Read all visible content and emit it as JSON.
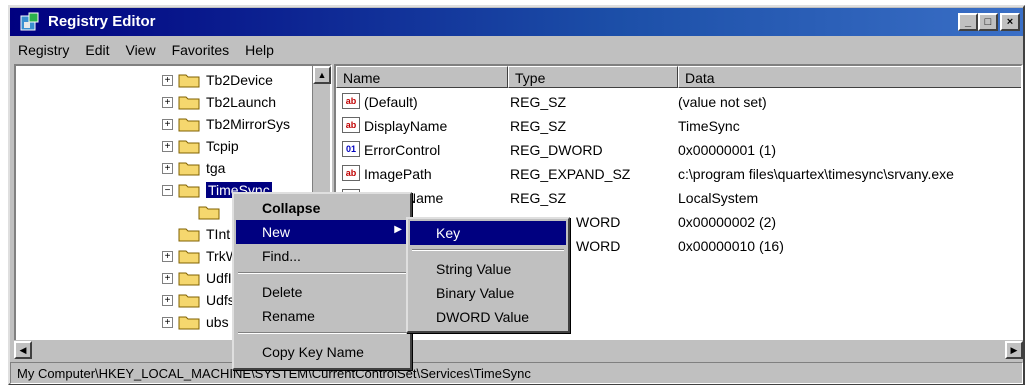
{
  "window": {
    "title": "Registry Editor",
    "buttons": [
      "_",
      "□",
      "×"
    ]
  },
  "menubar": [
    "Registry",
    "Edit",
    "View",
    "Favorites",
    "Help"
  ],
  "tree": {
    "items": [
      {
        "label": "Tb2Device",
        "expander": "+"
      },
      {
        "label": "Tb2Launch",
        "expander": "+"
      },
      {
        "label": "Tb2MirrorSys",
        "expander": "+"
      },
      {
        "label": "Tcpip",
        "expander": "+"
      },
      {
        "label": "tga",
        "expander": "+"
      },
      {
        "label": "TimeSync",
        "expander": "−",
        "selected": true
      },
      {
        "label": "",
        "expander": ""
      },
      {
        "label": "TInt",
        "expander": ""
      },
      {
        "label": "TrkW",
        "expander": "+"
      },
      {
        "label": "UdfI",
        "expander": "+"
      },
      {
        "label": "Udfs",
        "expander": "+"
      },
      {
        "label": "ubs",
        "expander": "+"
      }
    ]
  },
  "list": {
    "headers": [
      "Name",
      "Type",
      "Data"
    ],
    "rows": [
      {
        "icon": "ab",
        "name": "(Default)",
        "type": "REG_SZ",
        "data": "(value not set)"
      },
      {
        "icon": "ab",
        "name": "DisplayName",
        "type": "REG_SZ",
        "data": "TimeSync"
      },
      {
        "icon": "01",
        "name": "ErrorControl",
        "type": "REG_DWORD",
        "data": "0x00000001 (1)"
      },
      {
        "icon": "ab",
        "name": "ImagePath",
        "type": "REG_EXPAND_SZ",
        "data": "c:\\program files\\quartex\\timesync\\srvany.exe"
      },
      {
        "icon": "ab",
        "name": "Name",
        "type": "REG_SZ",
        "data": "LocalSystem"
      },
      {
        "icon": "01",
        "name": "",
        "type": "WORD",
        "data": "0x00000002 (2)"
      },
      {
        "icon": "01",
        "name": "",
        "type": "WORD",
        "data": "0x00000010 (16)"
      }
    ]
  },
  "context_menu": {
    "items": [
      "Collapse",
      "New",
      "Find...",
      "Delete",
      "Rename",
      "Copy Key Name"
    ],
    "submenu_arrow": "▶"
  },
  "submenu": {
    "items": [
      "Key",
      "String Value",
      "Binary Value",
      "DWORD Value"
    ]
  },
  "status_bar": "My Computer\\HKEY_LOCAL_MACHINE\\SYSTEM\\CurrentControlSet\\Services\\TimeSync",
  "colors": {
    "titlebar": "#000080",
    "selection": "#000080",
    "face": "#c0c0c0",
    "folder": "#f5d76e"
  }
}
